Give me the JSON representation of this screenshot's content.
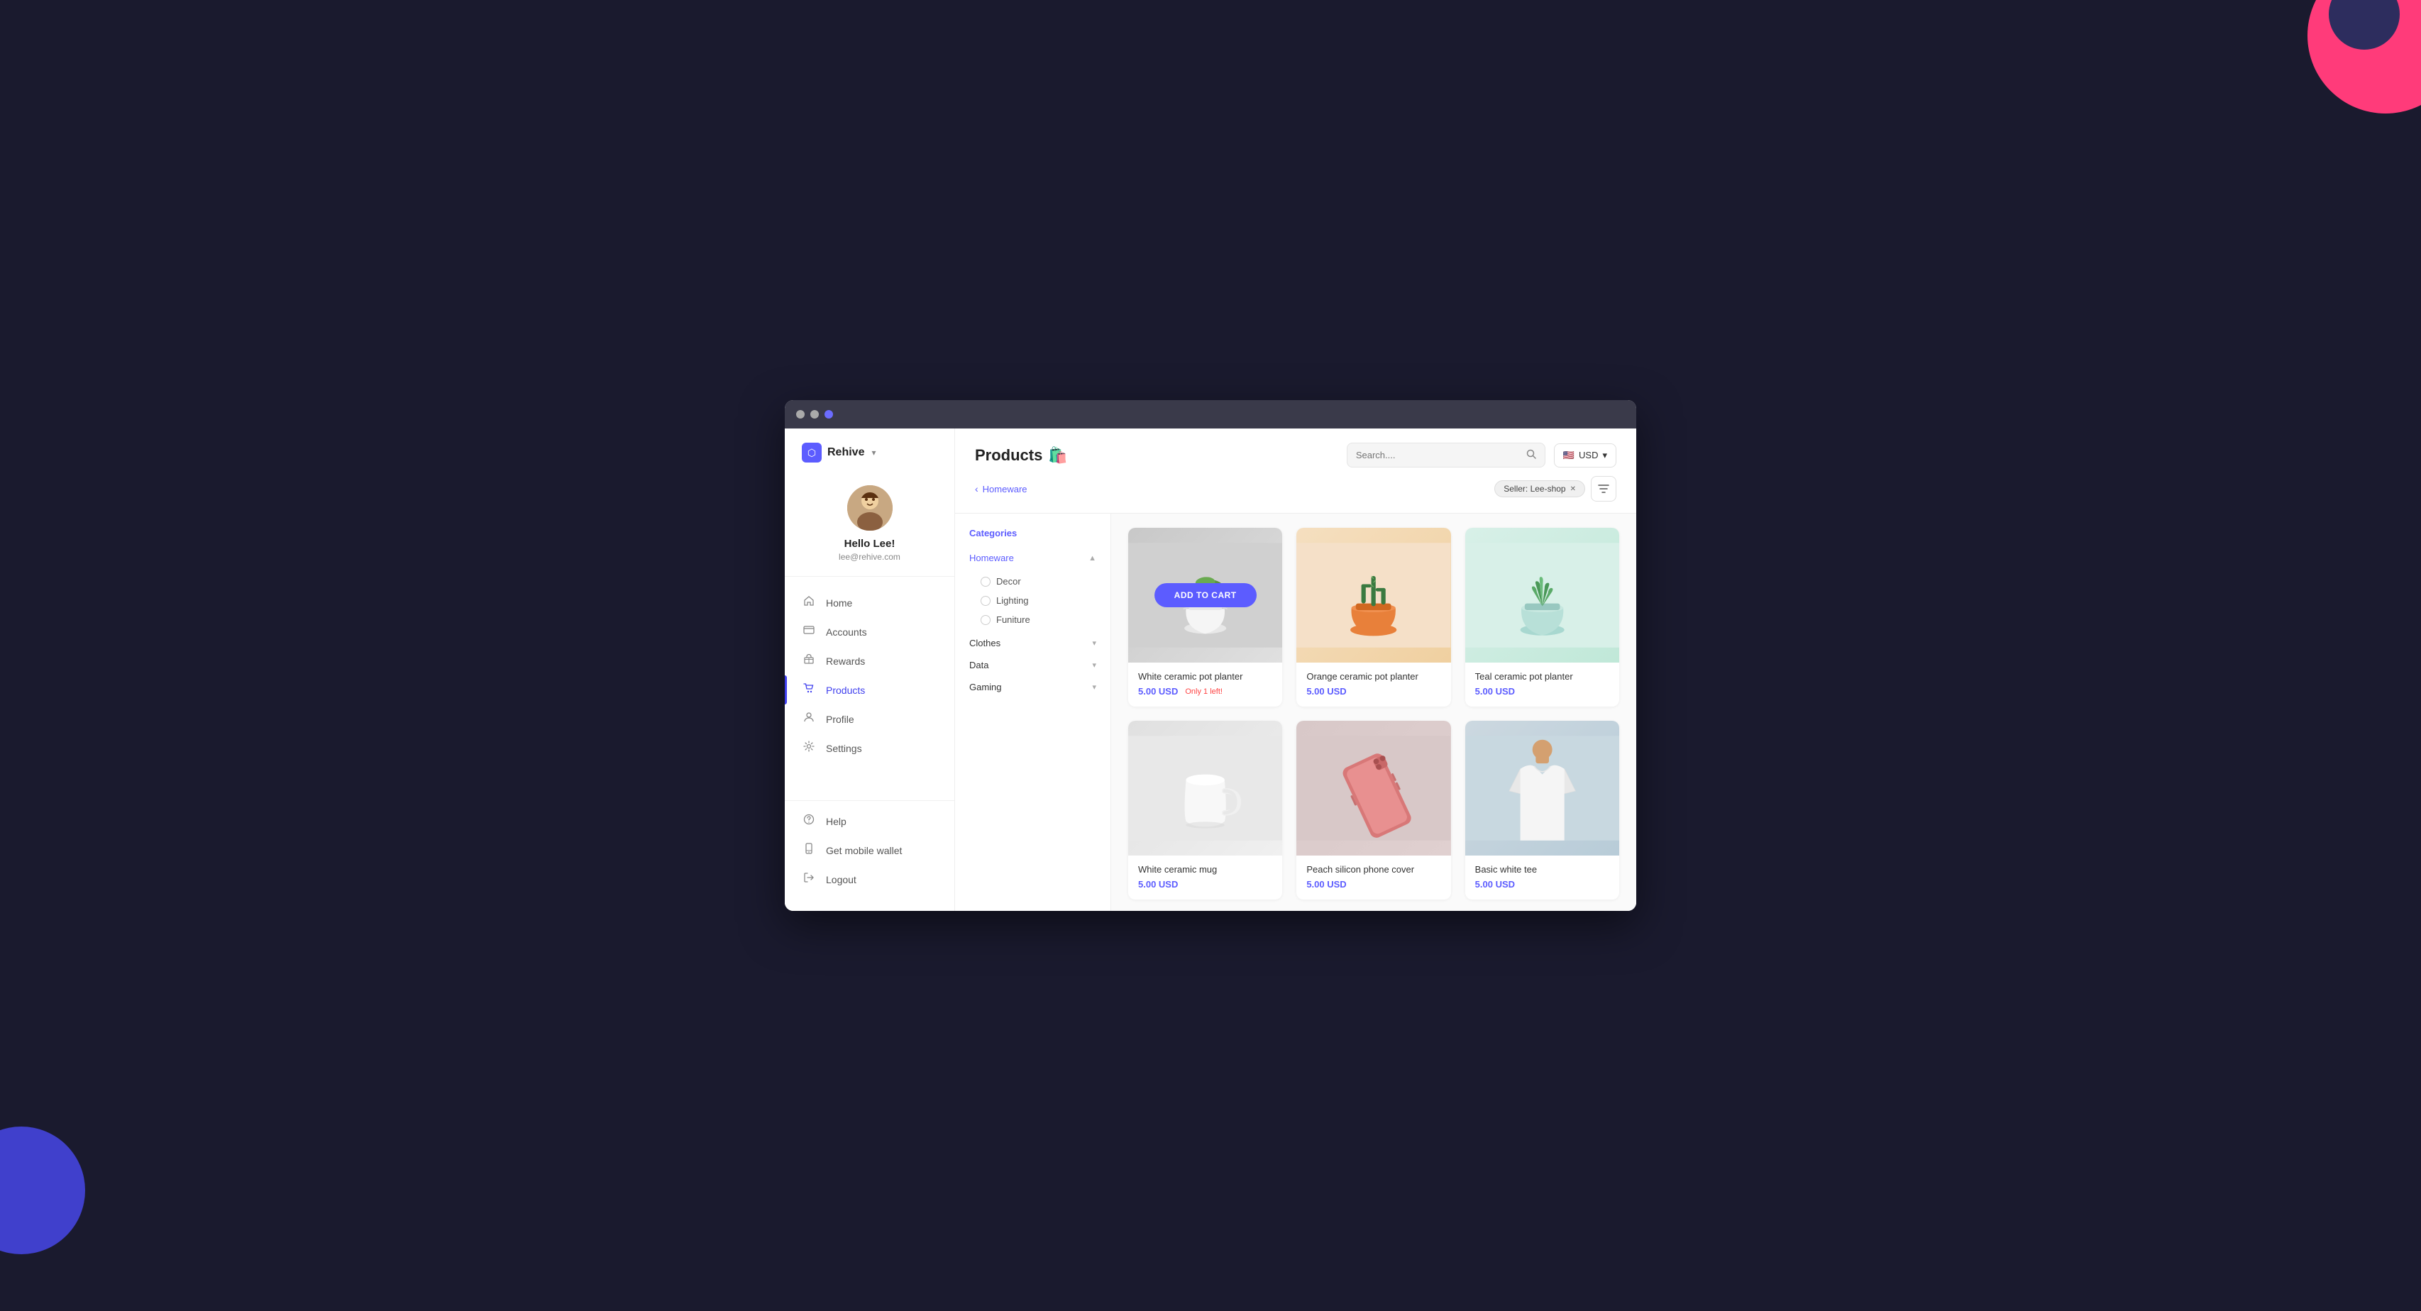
{
  "browser": {
    "dots": [
      "dot1",
      "dot2",
      "dot3"
    ]
  },
  "brand": {
    "name": "Rehive",
    "chevron": "▾"
  },
  "profile": {
    "greeting": "Hello Lee!",
    "email": "lee@rehive.com",
    "avatar_emoji": "👩"
  },
  "nav": {
    "items": [
      {
        "id": "home",
        "label": "Home",
        "icon": "🏠",
        "active": false
      },
      {
        "id": "accounts",
        "label": "Accounts",
        "icon": "🗂",
        "active": false
      },
      {
        "id": "rewards",
        "label": "Rewards",
        "icon": "🎁",
        "active": false
      },
      {
        "id": "products",
        "label": "Products",
        "icon": "🛒",
        "active": true
      },
      {
        "id": "profile",
        "label": "Profile",
        "icon": "👤",
        "active": false
      },
      {
        "id": "settings",
        "label": "Settings",
        "icon": "⚙️",
        "active": false
      }
    ],
    "bottom_items": [
      {
        "id": "help",
        "label": "Help",
        "icon": "❓"
      },
      {
        "id": "mobile-wallet",
        "label": "Get mobile wallet",
        "icon": "📲"
      },
      {
        "id": "logout",
        "label": "Logout",
        "icon": "🚪"
      }
    ]
  },
  "header": {
    "title": "Products",
    "title_emoji": "🛍️",
    "breadcrumb_label": "Homeware",
    "search_placeholder": "Search....",
    "currency": "USD",
    "seller_filter": "Seller: Lee-shop",
    "back_arrow": "‹"
  },
  "categories": {
    "title": "Categories",
    "items": [
      {
        "label": "Homeware",
        "expanded": true,
        "chevron": "▲",
        "subcategories": [
          {
            "label": "Decor"
          },
          {
            "label": "Lighting"
          },
          {
            "label": "Funiture"
          }
        ]
      },
      {
        "label": "Clothes",
        "expanded": false,
        "chevron": "▾",
        "subcategories": []
      },
      {
        "label": "Data",
        "expanded": false,
        "chevron": "▾",
        "subcategories": []
      },
      {
        "label": "Gaming",
        "expanded": false,
        "chevron": "▾",
        "subcategories": []
      }
    ]
  },
  "products": [
    {
      "id": "white-ceramic-pot",
      "name": "White ceramic pot planter",
      "price": "5.00 USD",
      "stock_note": "Only 1 left!",
      "bg_class": "bg-gray-light",
      "emoji": "🌿",
      "show_add_to_cart": true
    },
    {
      "id": "orange-ceramic-pot",
      "name": "Orange ceramic pot planter",
      "price": "5.00 USD",
      "stock_note": "",
      "bg_class": "bg-peach",
      "emoji": "🌵",
      "show_add_to_cart": false
    },
    {
      "id": "teal-ceramic-pot",
      "name": "Teal ceramic pot planter",
      "price": "5.00 USD",
      "stock_note": "",
      "bg_class": "bg-mint-light",
      "emoji": "🌱",
      "show_add_to_cart": false
    },
    {
      "id": "white-ceramic-mug",
      "name": "White ceramic mug",
      "price": "5.00 USD",
      "stock_note": "",
      "bg_class": "bg-white-gray",
      "emoji": "☕",
      "show_add_to_cart": false
    },
    {
      "id": "peach-phone-cover",
      "name": "Peach silicon phone cover",
      "price": "5.00 USD",
      "stock_note": "",
      "bg_class": "bg-light-gray",
      "emoji": "📱",
      "show_add_to_cart": false
    },
    {
      "id": "basic-white-tee",
      "name": "Basic white tee",
      "price": "5.00 USD",
      "stock_note": "",
      "bg_class": "bg-off-white",
      "emoji": "👕",
      "show_add_to_cart": false
    }
  ],
  "buttons": {
    "add_to_cart": "ADD TO CART"
  },
  "colors": {
    "primary": "#5c5cff",
    "danger": "#ff4444",
    "text_primary": "#222",
    "text_secondary": "#555"
  }
}
